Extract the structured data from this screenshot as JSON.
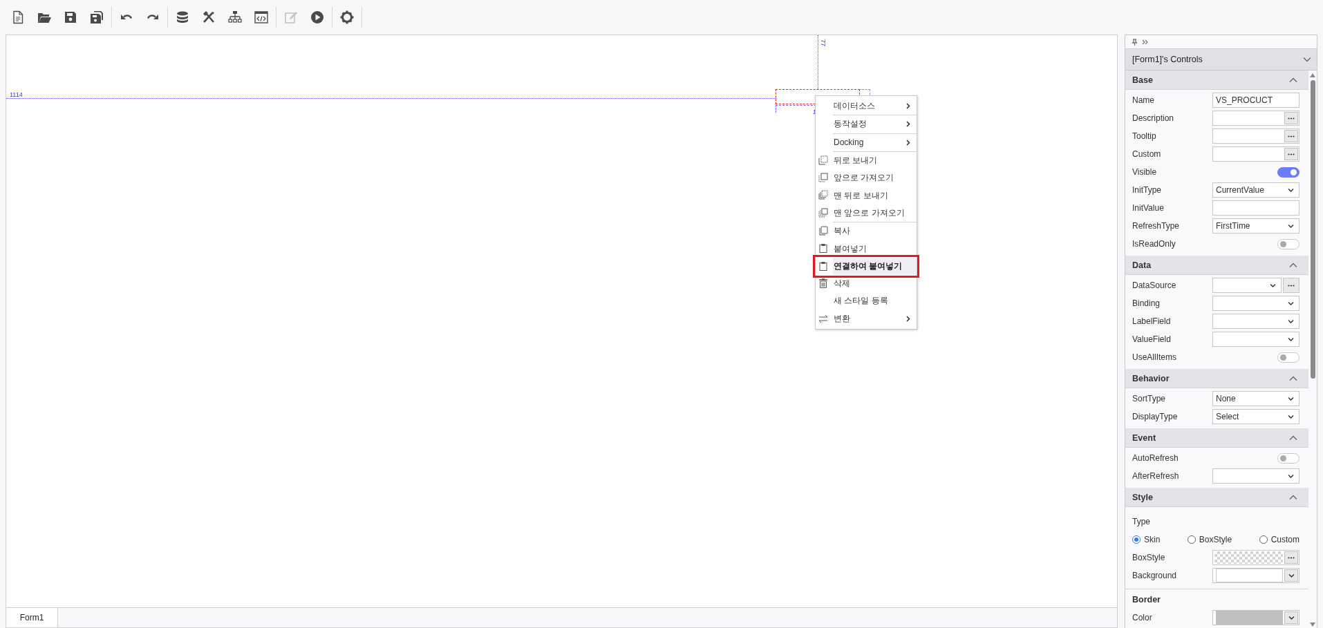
{
  "toolbar": [
    [
      {
        "disabled": false
      },
      {
        "disabled": false
      },
      {
        "disabled": false
      },
      {
        "disabled": false
      }
    ],
    [
      {
        "disabled": false
      },
      {
        "disabled": false
      }
    ],
    [
      {
        "disabled": false
      },
      {
        "disabled": false
      },
      {
        "disabled": false
      },
      {
        "disabled": false
      }
    ],
    [
      {
        "disabled": true
      },
      {
        "disabled": false
      }
    ],
    [
      {
        "disabled": false
      }
    ]
  ],
  "canvas": {
    "guide_labels": [
      "1114",
      "77",
      "1"
    ],
    "context_menu": [
      {
        "label": "데이터소스",
        "submenu": true,
        "separator_after": true,
        "selected": false
      },
      {
        "label": "동작설정",
        "submenu": true,
        "separator_after": true,
        "selected": false
      },
      {
        "label": "Docking",
        "submenu": true,
        "separator_after": true,
        "selected": false
      },
      {
        "label": "뒤로 보내기",
        "submenu": false,
        "separator_after": false,
        "selected": false
      },
      {
        "label": "앞으로 가져오기",
        "submenu": false,
        "separator_after": false,
        "selected": false
      },
      {
        "label": "맨 뒤로 보내기",
        "submenu": false,
        "separator_after": false,
        "selected": false
      },
      {
        "label": "맨 앞으로 가져오기",
        "submenu": false,
        "separator_after": true,
        "selected": false
      },
      {
        "label": "복사",
        "submenu": false,
        "separator_after": false,
        "selected": false
      },
      {
        "label": "붙여넣기",
        "submenu": false,
        "separator_after": false,
        "selected": false
      },
      {
        "label": "연결하여 붙여넣기",
        "submenu": false,
        "separator_after": false,
        "selected": true
      },
      {
        "label": "삭제",
        "submenu": false,
        "separator_after": false,
        "selected": false
      },
      {
        "label": "새 스타일 등록",
        "submenu": false,
        "separator_after": false,
        "selected": false
      },
      {
        "label": "변환",
        "submenu": true,
        "separator_after": false,
        "selected": false
      }
    ],
    "tabs": [
      {
        "label": "Form1",
        "selected": true
      }
    ]
  },
  "panel": {
    "title": "[Form1]'s Controls",
    "sections": [
      {
        "kind": "group",
        "title": "Base",
        "expanded": true,
        "rows": [
          {
            "kind": "text",
            "label": "Name",
            "value": "VS_PROCUCT"
          },
          {
            "kind": "ellipsis",
            "label": "Description"
          },
          {
            "kind": "ellipsis",
            "label": "Tooltip"
          },
          {
            "kind": "ellipsis",
            "label": "Custom"
          },
          {
            "kind": "toggle",
            "label": "Visible",
            "on": true
          },
          {
            "kind": "select",
            "label": "InitType",
            "value": "CurrentValue"
          },
          {
            "kind": "text",
            "label": "InitValue"
          },
          {
            "kind": "select",
            "label": "RefreshType",
            "value": "FirstTime"
          },
          {
            "kind": "toggle",
            "label": "IsReadOnly",
            "on": false
          }
        ]
      },
      {
        "kind": "group",
        "title": "Data",
        "expanded": true,
        "rows": [
          {
            "kind": "select_more",
            "label": "DataSource"
          },
          {
            "kind": "select",
            "label": "Binding"
          },
          {
            "kind": "select",
            "label": "LabelField"
          },
          {
            "kind": "select",
            "label": "ValueField"
          },
          {
            "kind": "toggle",
            "label": "UseAllItems",
            "on": false
          }
        ]
      },
      {
        "kind": "group",
        "title": "Behavior",
        "expanded": true,
        "rows": [
          {
            "kind": "select",
            "label": "SortType",
            "value": "None"
          },
          {
            "kind": "select",
            "label": "DisplayType",
            "value": "Select"
          }
        ]
      },
      {
        "kind": "group",
        "title": "Event",
        "expanded": true,
        "rows": [
          {
            "kind": "toggle",
            "label": "AutoRefresh",
            "on": false
          },
          {
            "kind": "select",
            "label": "AfterRefresh"
          }
        ]
      },
      {
        "kind": "group",
        "title": "Style",
        "expanded": true,
        "rows": [
          {
            "kind": "caption",
            "label": "Type"
          },
          {
            "kind": "radio",
            "options": [
              {
                "label": "Skin",
                "selected": true
              },
              {
                "label": "BoxStyle",
                "selected": false
              },
              {
                "label": "Custom",
                "selected": false
              }
            ]
          },
          {
            "kind": "pattern",
            "label": "BoxStyle"
          },
          {
            "kind": "color",
            "label": "Background"
          }
        ]
      },
      {
        "kind": "subgroup",
        "title": "Border",
        "rows": [
          {
            "kind": "color_set",
            "label": "Color"
          }
        ]
      }
    ]
  }
}
